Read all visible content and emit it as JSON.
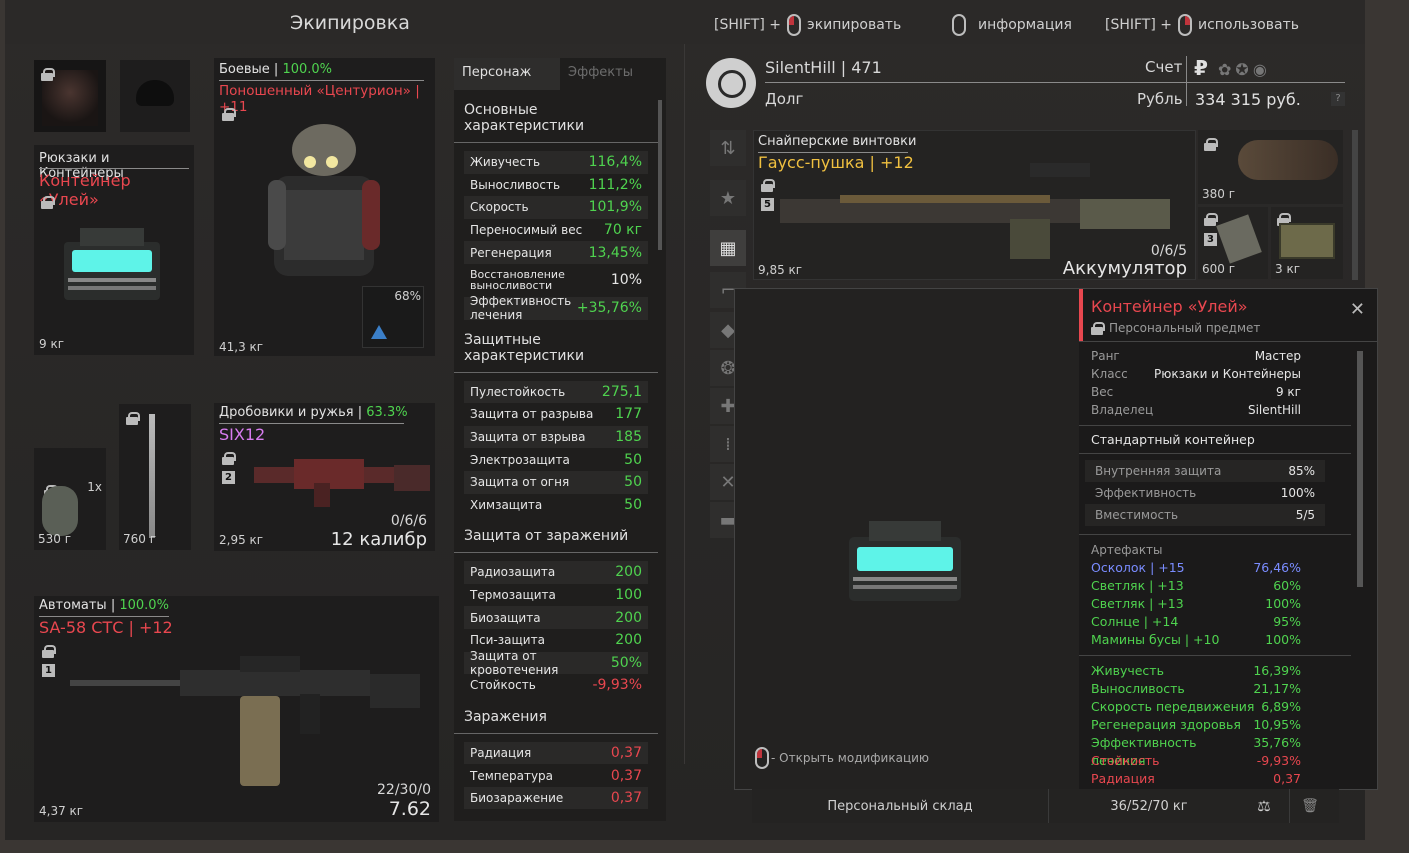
{
  "header": {
    "title": "Экипировка",
    "hints": [
      {
        "prefix": "[SHIFT] +",
        "label": "экипировать"
      },
      {
        "prefix": "",
        "label": "информация"
      },
      {
        "prefix": "[SHIFT] +",
        "label": "использовать"
      }
    ]
  },
  "equipment": {
    "backpack": {
      "category": "Рюкзаки и Контейнеры",
      "name": "Контейнер «Улей»",
      "weight": "9 кг"
    },
    "armor": {
      "category": "Боевые",
      "durability": "100.0%",
      "name": "Поношенный «Центурион» | +11",
      "weight": "41,3 кг",
      "artifact_pct": "68%"
    },
    "grenade": {
      "count": "1x",
      "weight": "530 г"
    },
    "melee": {
      "weight": "760 г"
    },
    "secondary": {
      "category": "Дробовики и ружья",
      "durability": "63.3%",
      "name": "SIX12",
      "slot": "2",
      "weight": "2,95 кг",
      "ammo": "0/6/6",
      "caliber": "12 калибр"
    },
    "primary": {
      "category": "Автоматы",
      "durability": "100.0%",
      "name": "SA-58 СТС | +12",
      "slot": "1",
      "weight": "4,37 кг",
      "ammo": "22/30/0",
      "caliber": "7.62"
    }
  },
  "stats_panel": {
    "tabs": [
      "Персонаж",
      "Эффекты"
    ],
    "sections": [
      {
        "title": "Основные характеристики",
        "rows": [
          {
            "k": "Живучесть",
            "v": "116,4%",
            "c": "g"
          },
          {
            "k": "Выносливость",
            "v": "111,2%",
            "c": "g"
          },
          {
            "k": "Скорость",
            "v": "101,9%",
            "c": "g"
          },
          {
            "k": "Переносимый вес",
            "v": "70 кг",
            "c": "g"
          },
          {
            "k": "Регенерация",
            "v": "13,45%",
            "c": "g"
          },
          {
            "k": "Восстановление выносливости",
            "v": "10%",
            "c": "w"
          },
          {
            "k": "Эффективность лечения",
            "v": "+35,76%",
            "c": "g"
          }
        ]
      },
      {
        "title": "Защитные характеристики",
        "rows": [
          {
            "k": "Пулестойкость",
            "v": "275,1",
            "c": "g"
          },
          {
            "k": "Защита от разрыва",
            "v": "177",
            "c": "g"
          },
          {
            "k": "Защита от взрыва",
            "v": "185",
            "c": "g"
          },
          {
            "k": "Электрозащита",
            "v": "50",
            "c": "g"
          },
          {
            "k": "Защита от огня",
            "v": "50",
            "c": "g"
          },
          {
            "k": "Химзащита",
            "v": "50",
            "c": "g"
          }
        ]
      },
      {
        "title": "Защита от заражений",
        "rows": [
          {
            "k": "Радиозащита",
            "v": "200",
            "c": "g"
          },
          {
            "k": "Термозащита",
            "v": "100",
            "c": "g"
          },
          {
            "k": "Биозащита",
            "v": "200",
            "c": "g"
          },
          {
            "k": "Пси-защита",
            "v": "200",
            "c": "g"
          },
          {
            "k": "Защита от кровотечения",
            "v": "50%",
            "c": "g"
          },
          {
            "k": "Стойкость",
            "v": "-9,93%",
            "c": "r"
          }
        ]
      },
      {
        "title": "Заражения",
        "rows": [
          {
            "k": "Радиация",
            "v": "0,37",
            "c": "r"
          },
          {
            "k": "Температура",
            "v": "0,37",
            "c": "r"
          },
          {
            "k": "Биозаражение",
            "v": "0,37",
            "c": "r"
          }
        ]
      }
    ]
  },
  "profile": {
    "name": "SilentHill | 471",
    "debt_label": "Долг",
    "account_label": "Счет",
    "currency_label": "Рубль",
    "balance": "334 315 руб.",
    "help": "?"
  },
  "stash": {
    "featured": {
      "category": "Снайперские винтовки",
      "name": "Гаусс-пушка | +12",
      "slot": "5",
      "weight": "9,85 кг",
      "ammo": "0/6/5",
      "ammo_type": "Аккумулятор"
    },
    "side_items": [
      {
        "weight": "380 г"
      },
      {
        "weight": "600 г",
        "count": "3"
      },
      {
        "weight": "3 кг"
      }
    ],
    "bottom_label": "Персональный склад",
    "capacity": "36/52/70 кг"
  },
  "popup": {
    "title": "Контейнер «Улей»",
    "subtitle": "Персональный предмет",
    "props": [
      {
        "k": "Ранг",
        "v": "Мастер",
        "c": "red"
      },
      {
        "k": "Класс",
        "v": "Рюкзаки и Контейнеры",
        "c": ""
      },
      {
        "k": "Вес",
        "v": "9 кг",
        "c": ""
      },
      {
        "k": "Владелец",
        "v": "SilentHill",
        "c": ""
      }
    ],
    "container_type": "Стандартный контейнер",
    "container_stats": [
      {
        "k": "Внутренняя защита",
        "v": "85%"
      },
      {
        "k": "Эффективность",
        "v": "100%"
      },
      {
        "k": "Вместимость",
        "v": "5/5"
      }
    ],
    "artifacts_title": "Артефакты",
    "artifacts": [
      {
        "k": "Осколок | +15",
        "v": "76,46%",
        "c": "blue"
      },
      {
        "k": "Светляк | +13",
        "v": "60%",
        "c": "green"
      },
      {
        "k": "Светляк | +13",
        "v": "100%",
        "c": "green"
      },
      {
        "k": "Солнце | +14",
        "v": "95%",
        "c": "green"
      },
      {
        "k": "Мамины бусы | +10",
        "v": "100%",
        "c": "green"
      }
    ],
    "effects": [
      {
        "k": "Живучесть",
        "v": "16,39%",
        "c": "green"
      },
      {
        "k": "Выносливость",
        "v": "21,17%",
        "c": "green"
      },
      {
        "k": "Скорость передвижения",
        "v": "6,89%",
        "c": "green"
      },
      {
        "k": "Регенерация здоровья",
        "v": "10,95%",
        "c": "green"
      },
      {
        "k": "Эффективность лечения",
        "v": "35,76%",
        "c": "green"
      },
      {
        "k": "Стойкость",
        "v": "-9,93%",
        "c": "red"
      },
      {
        "k": "Радиация",
        "v": "0,37",
        "c": "red"
      }
    ],
    "mod_hint": "- Открыть модификацию"
  }
}
